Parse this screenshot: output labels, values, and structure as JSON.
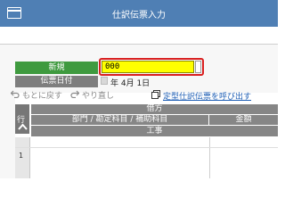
{
  "window": {
    "title": "仕訳伝票入力",
    "icon": "window-icon"
  },
  "form": {
    "shinki_label": "新規",
    "shinki_value": "000",
    "date_label": "伝票日付",
    "date_value": "年  4月  1日",
    "input_bg": "#ffff00",
    "highlight_color": "#d92020"
  },
  "toolbar": {
    "undo_label": "もとに戻す",
    "redo_label": "やり直し",
    "template_link": "定型仕訳伝票を呼び出す",
    "undo_icon": "undo-icon",
    "redo_icon": "redo-icon",
    "template_icon": "template-icon"
  },
  "grid": {
    "row_header": "行",
    "debit_header": "借方",
    "dept_account_header": "部門 / 勘定科目 / 補助科目",
    "amount_header": "金額",
    "construction_header": "工事",
    "rows": [
      {
        "line_no": "1"
      }
    ]
  }
}
